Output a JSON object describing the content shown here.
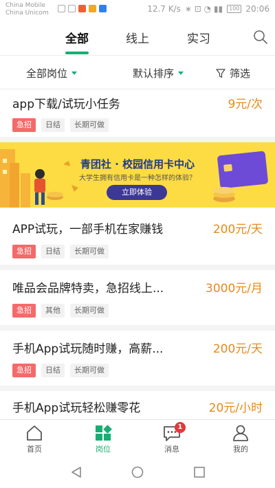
{
  "status_bar": {
    "carrier_1": "China Mobile",
    "carrier_2": "China Unicom",
    "speed": "12.7 K/s",
    "battery": "100",
    "time": "20:06"
  },
  "top_tabs": [
    {
      "label": "全部"
    },
    {
      "label": "线上"
    },
    {
      "label": "实习"
    }
  ],
  "filters": {
    "position": "全部岗位",
    "sort": "默认排序",
    "filter": "筛选"
  },
  "jobs": [
    {
      "title": "app下载/试玩小任务",
      "pay": "9元/次",
      "tags": [
        "急招",
        "日结",
        "长期可做"
      ]
    },
    {
      "title": "APP试玩，一部手机在家赚钱",
      "pay": "200元/天",
      "tags": [
        "急招",
        "日结",
        "长期可做"
      ]
    },
    {
      "title": "唯品会品牌特卖，急招线上...",
      "pay": "3000元/月",
      "tags": [
        "急招",
        "其他",
        "长期可做"
      ]
    },
    {
      "title": "手机App试玩随时赚，高薪...",
      "pay": "200元/天",
      "tags": [
        "急招",
        "日结",
        "长期可做"
      ]
    },
    {
      "title": "手机App试玩轻松赚零花",
      "pay": "20元/小时",
      "tags": []
    }
  ],
  "banner": {
    "title": "青团社 · 校园信用卡中心",
    "subtitle": "大学生拥有信用卡是一种怎样的体验？",
    "button": "立即体验"
  },
  "bottom_nav": [
    {
      "label": "首页",
      "icon": "home-icon"
    },
    {
      "label": "岗位",
      "icon": "jobs-icon"
    },
    {
      "label": "消息",
      "icon": "message-icon",
      "badge": "1"
    },
    {
      "label": "我的",
      "icon": "profile-icon"
    }
  ],
  "colors": {
    "accent": "#1aad74",
    "pay": "#e8891a",
    "urgent": "#f46a6a",
    "banner_bg": "#fcdc42"
  }
}
